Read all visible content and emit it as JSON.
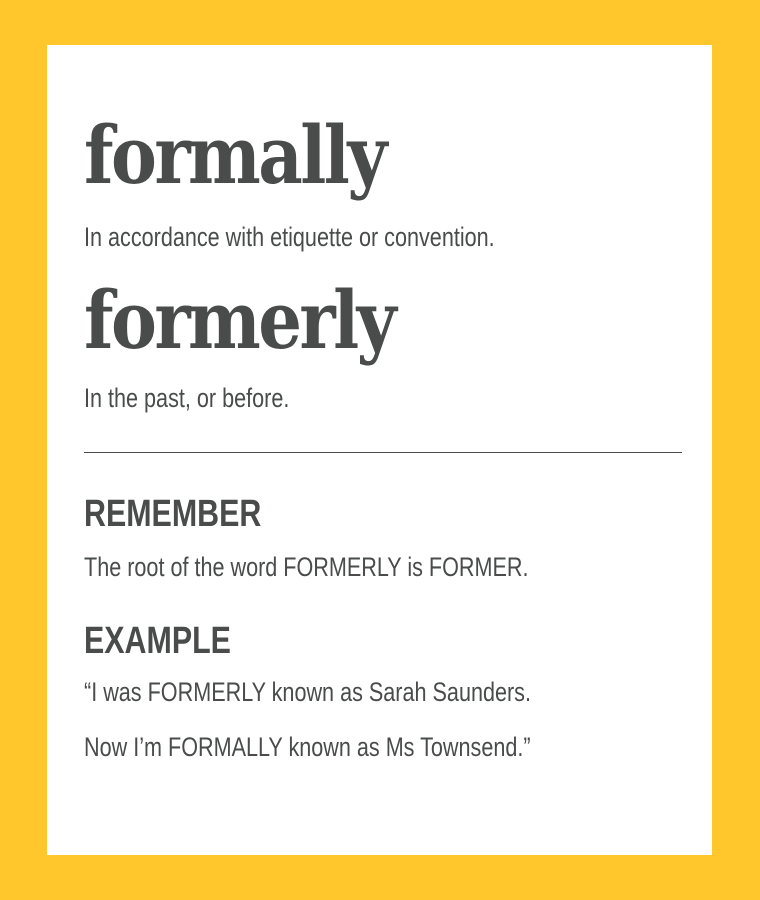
{
  "entries": [
    {
      "word": "formally",
      "definition": "In accordance with etiquette or convention."
    },
    {
      "word": "formerly",
      "definition": "In the past, or before."
    }
  ],
  "remember": {
    "heading": "REMEMBER",
    "text": "The root of the word FORMERLY is FORMER."
  },
  "example": {
    "heading": "EXAMPLE",
    "lines": [
      "“I was FORMERLY known as Sarah Saunders.",
      "Now I’m FORMALLY known as Ms Townsend.”"
    ]
  },
  "colors": {
    "frame": "#FFC72C",
    "card": "#ffffff",
    "text": "#4a4c4c"
  }
}
